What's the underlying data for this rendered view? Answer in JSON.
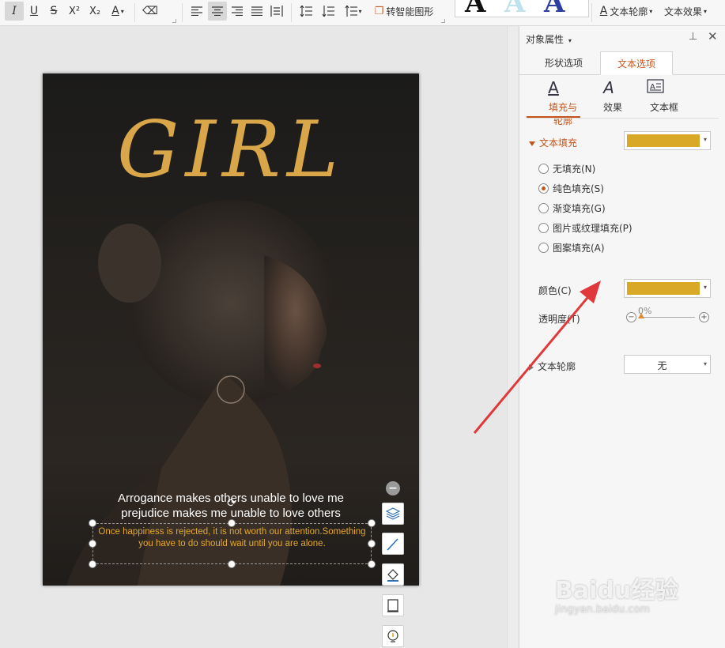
{
  "ribbon": {
    "italic": "I",
    "underline": "U",
    "strike": "S",
    "superscript": "X²",
    "subscript": "X₂",
    "font_color": "A",
    "smart_shape_label": "转智能图形",
    "text_outline_label": "文本轮廓",
    "text_effect_label": "文本效果",
    "gallery_letter": "A"
  },
  "document": {
    "title": "GIRL",
    "line1": "Arrogance makes others unable to love me",
    "line2": "prejudice makes me unable to love others",
    "small_text": "Once happiness is rejected, it is not worth our attention.Something you have to do should wait until you are alone."
  },
  "panel": {
    "title": "对象属性",
    "tabs": [
      "形状选项",
      "文本选项"
    ],
    "subtabs": [
      "填充与轮廓",
      "效果",
      "文本框"
    ],
    "text_fill": {
      "label": "文本填充",
      "color": "#d8a826",
      "options": [
        "无填充(N)",
        "纯色填充(S)",
        "渐变填充(G)",
        "图片或纹理填充(P)",
        "图案填充(A)"
      ],
      "selected_index": 1
    },
    "color_label": "颜色(C)",
    "color_value": "#d8a826",
    "transparency_label": "透明度(T)",
    "transparency_value": "0%",
    "text_outline": {
      "label": "文本轮廓",
      "value": "无"
    }
  },
  "watermark": {
    "main": "Baidu经验",
    "sub": "jingyan.baidu.com"
  },
  "colors": {
    "accent": "#c5541b",
    "title_gold": "#d9a64a",
    "annotation_arrow": "#e0393b"
  }
}
